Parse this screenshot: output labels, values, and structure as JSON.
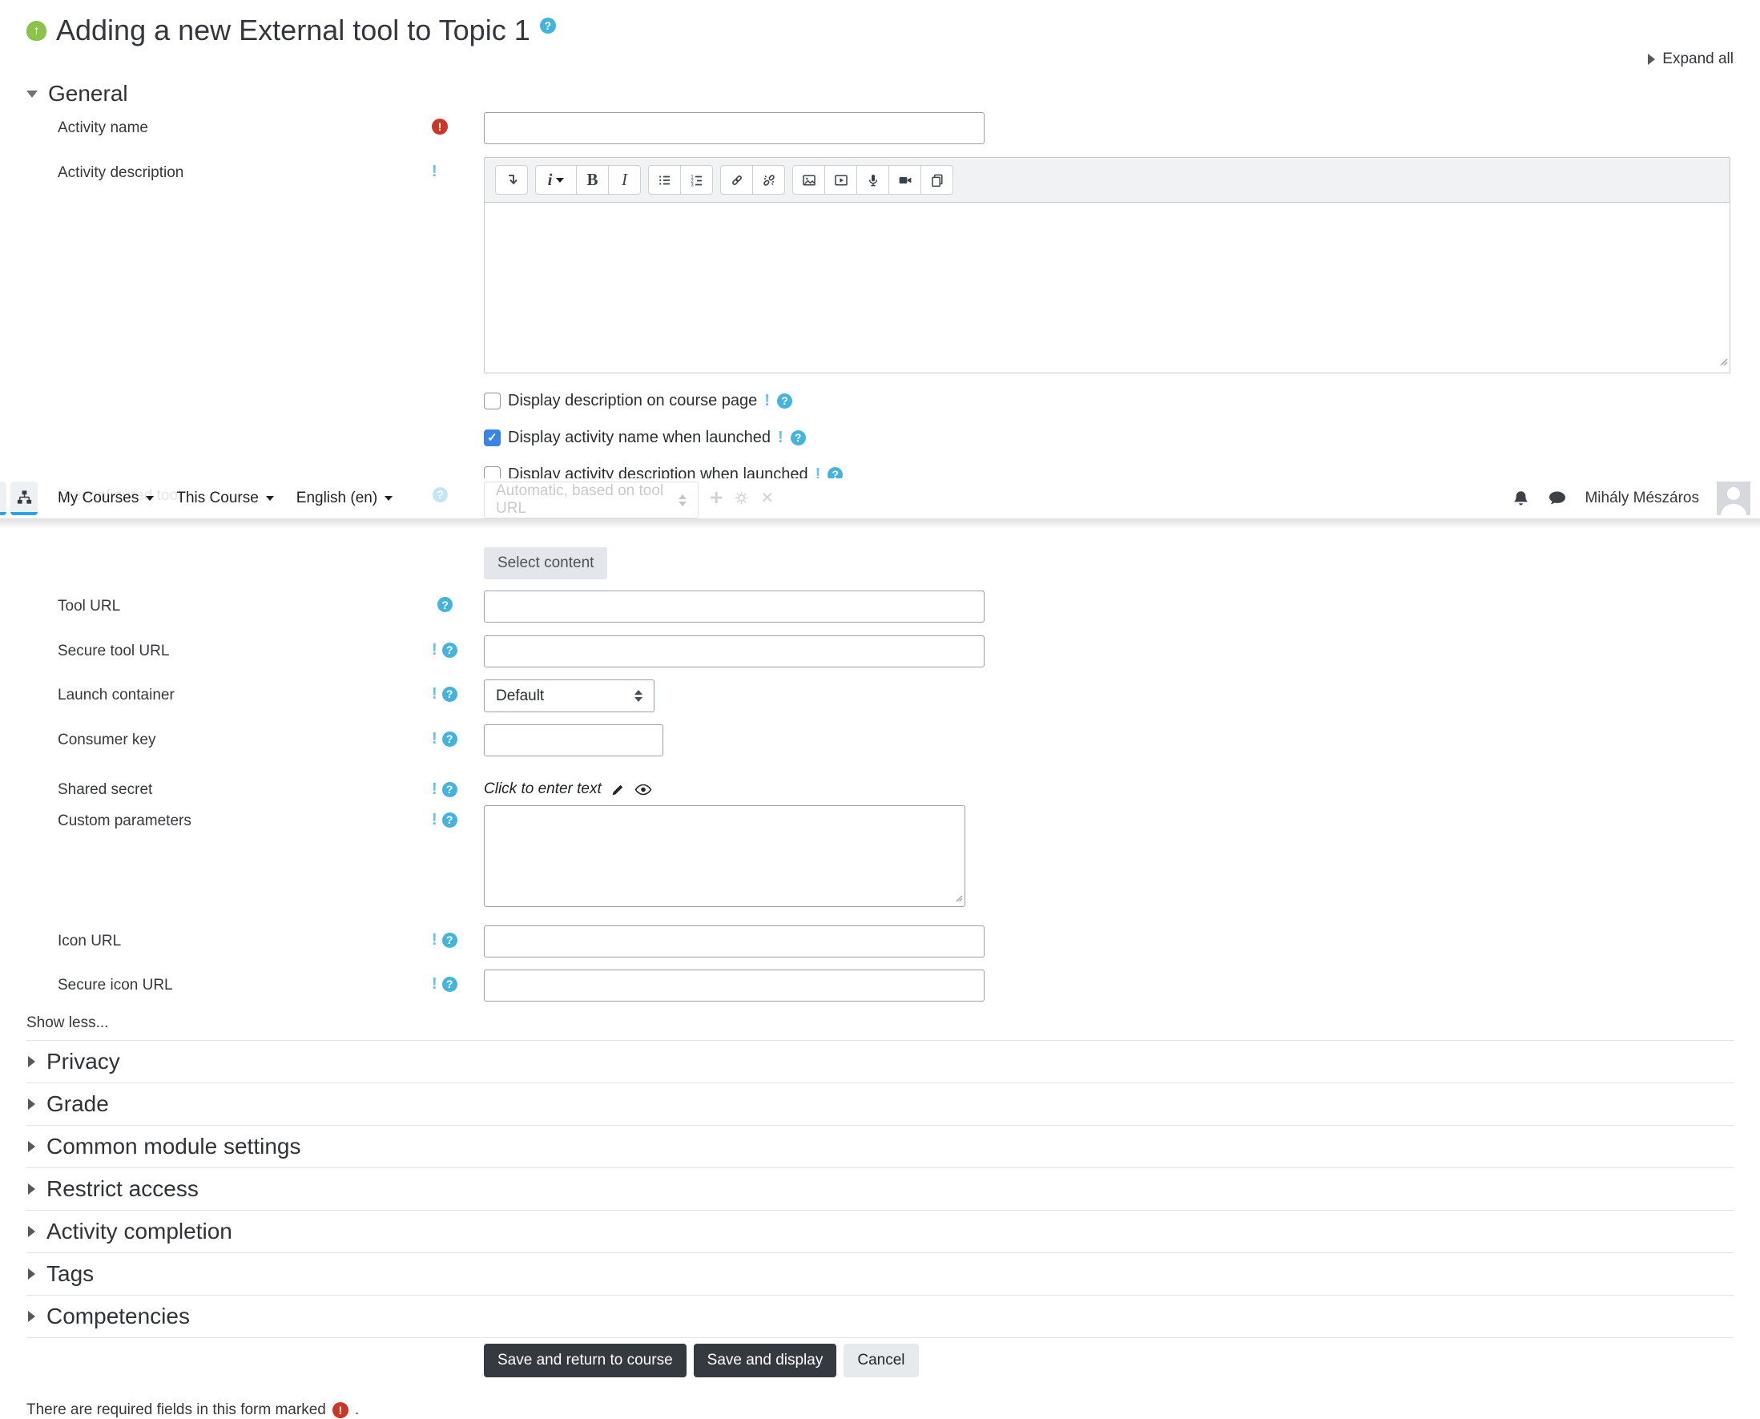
{
  "page": {
    "title": "Adding a new External tool to Topic 1",
    "expand_all_label": "Expand all",
    "show_less_label": "Show less...",
    "required_note": "There are required fields in this form marked",
    "required_note_period": "."
  },
  "navbar": {
    "items": [
      {
        "label": "My Courses"
      },
      {
        "label": "This Course"
      },
      {
        "label": "English (en)"
      }
    ],
    "user_name": "Mihály Mészáros"
  },
  "general": {
    "heading": "General",
    "rows": {
      "activity_name": {
        "label": "Activity name",
        "value": "",
        "required": true
      },
      "activity_description": {
        "label": "Activity description",
        "value": ""
      },
      "preconfigured_tool": {
        "label": "Preconfigured tool",
        "value": "Automatic, based on tool URL"
      },
      "tool_url": {
        "label": "Tool URL",
        "value": ""
      },
      "secure_tool_url": {
        "label": "Secure tool URL",
        "value": ""
      },
      "launch_container": {
        "label": "Launch container",
        "value": "Default"
      },
      "consumer_key": {
        "label": "Consumer key",
        "value": ""
      },
      "shared_secret": {
        "label": "Shared secret",
        "value": "Click to enter text"
      },
      "custom_parameters": {
        "label": "Custom parameters",
        "value": ""
      },
      "icon_url": {
        "label": "Icon URL",
        "value": ""
      },
      "secure_icon_url": {
        "label": "Secure icon URL",
        "value": ""
      }
    },
    "checkboxes": [
      {
        "label": "Display description on course page",
        "checked": false
      },
      {
        "label": "Display activity name when launched",
        "checked": true
      },
      {
        "label": "Display activity description when launched",
        "checked": false
      }
    ],
    "select_content_label": "Select content"
  },
  "editor": {
    "toolbar_icons": [
      "collapse-toolbar-icon",
      "paragraph-style-icon",
      "bold-icon",
      "italic-icon",
      "unordered-list-icon",
      "ordered-list-icon",
      "link-icon",
      "unlink-icon",
      "image-icon",
      "media-icon",
      "record-audio-icon",
      "record-video-icon",
      "manage-files-icon"
    ]
  },
  "sections": [
    {
      "label": "Privacy"
    },
    {
      "label": "Grade"
    },
    {
      "label": "Common module settings"
    },
    {
      "label": "Restrict access"
    },
    {
      "label": "Activity completion"
    },
    {
      "label": "Tags"
    },
    {
      "label": "Competencies"
    }
  ],
  "actions": {
    "save_return_label": "Save and return to course",
    "save_display_label": "Save and display",
    "cancel_label": "Cancel"
  },
  "colors": {
    "accent_blue": "#2ea0f0",
    "help_blue": "#45b4dd",
    "advanced_blue": "#5fc3ef",
    "checkbox_blue": "#3a84e4",
    "required_red": "#ca3628",
    "button_dark": "#343a40"
  }
}
